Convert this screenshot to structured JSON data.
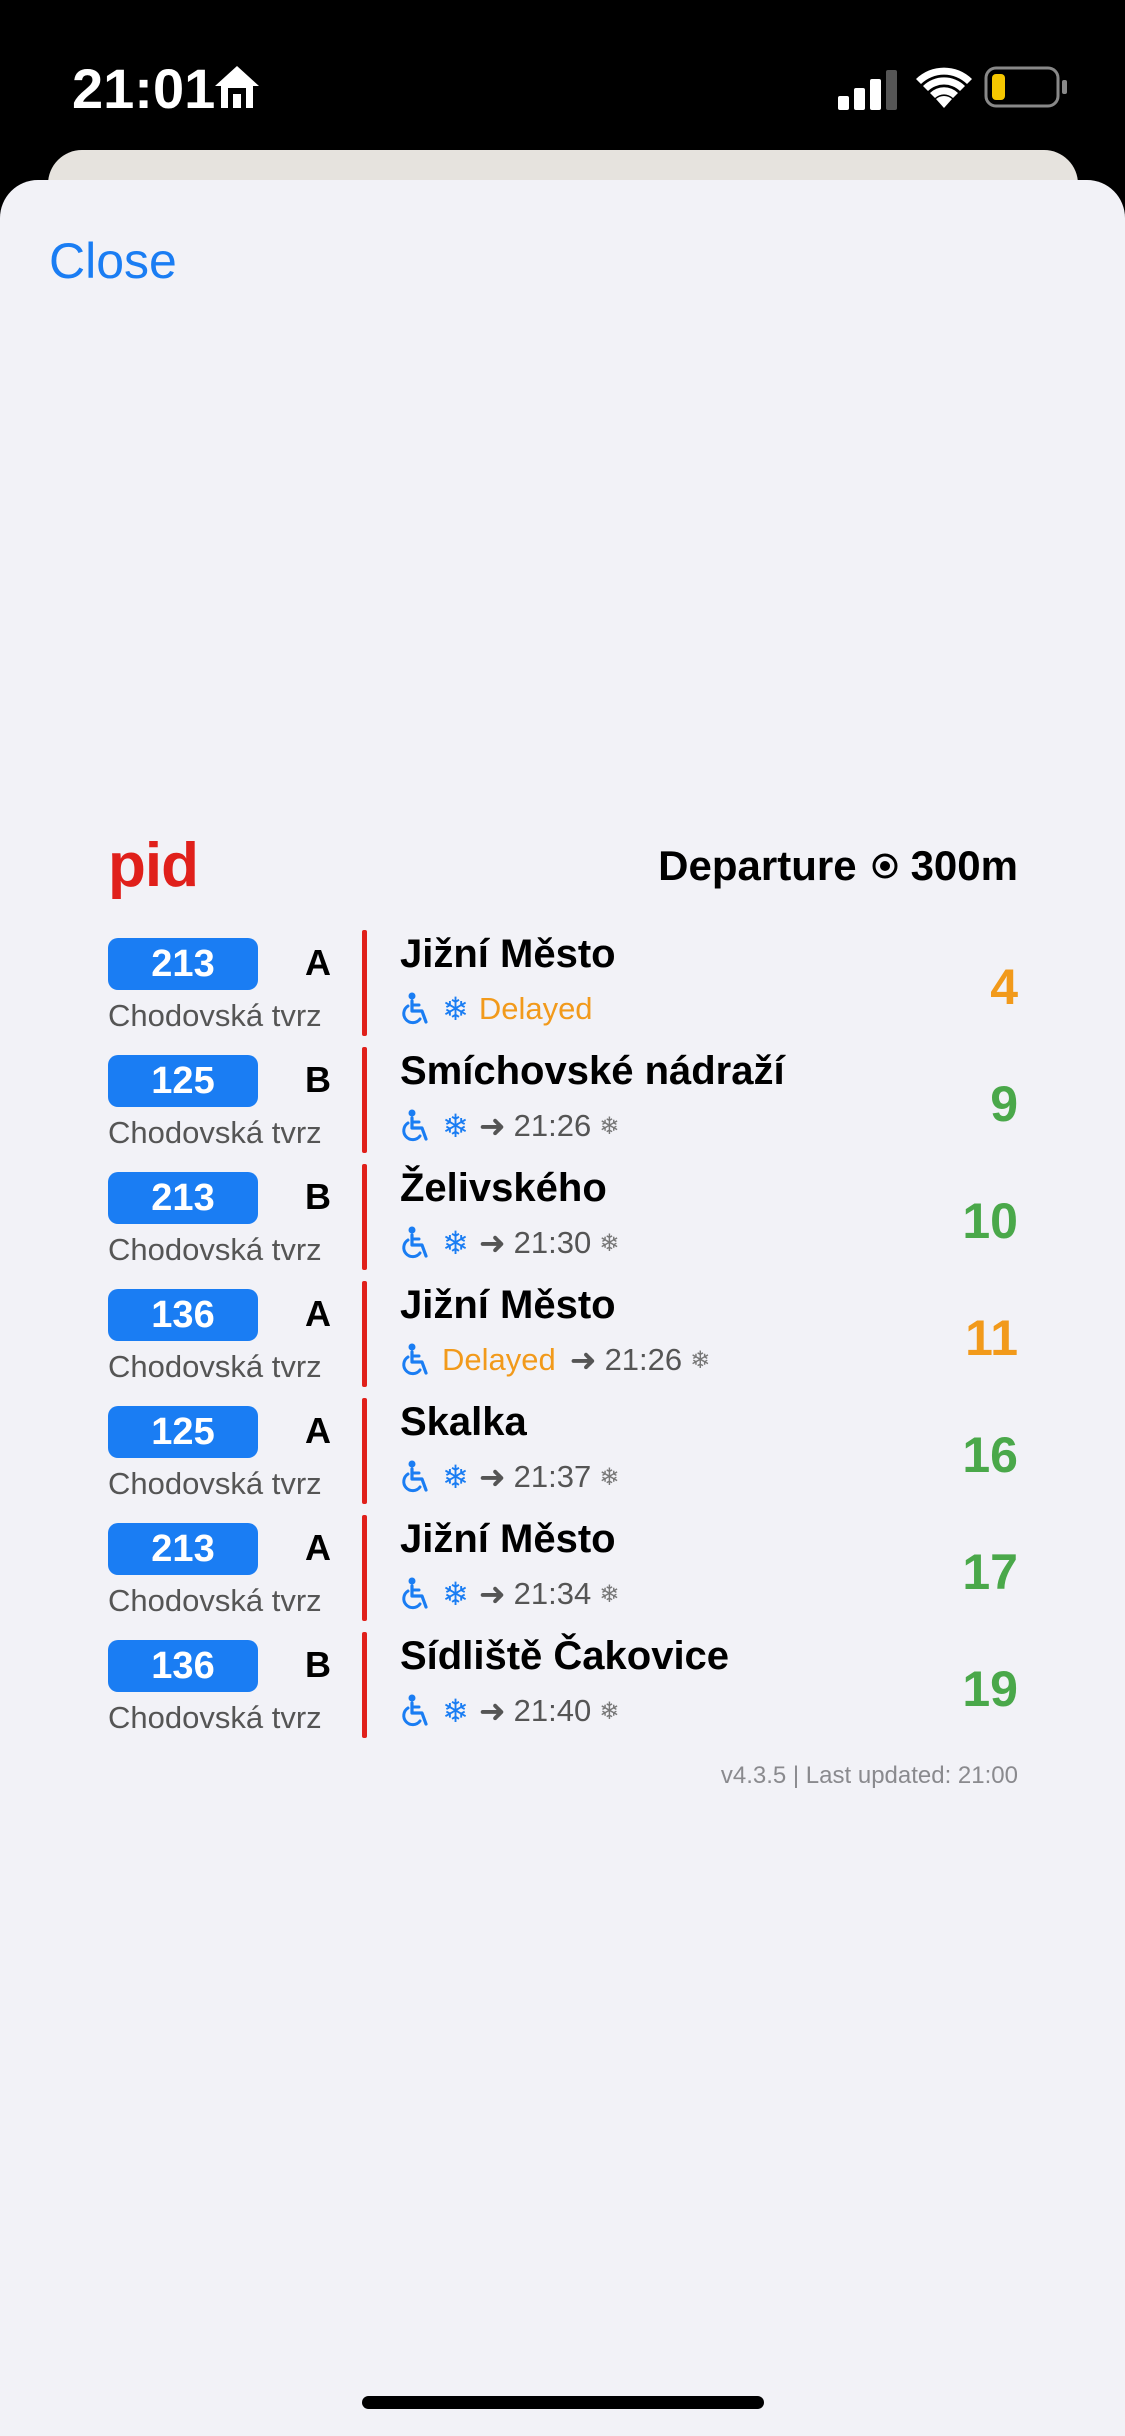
{
  "status_bar": {
    "time": "21:01",
    "battery_color": "#f6c700"
  },
  "sheet": {
    "close_label": "Close"
  },
  "widget": {
    "brand": "pid",
    "header": {
      "departure_label": "Departure",
      "distance": "300m"
    },
    "departures": [
      {
        "line": "213",
        "platform": "A",
        "stop": "Chodovská tvrz",
        "destination": "Jižní Město",
        "wheelchair": true,
        "ac": true,
        "delayed": true,
        "delayed_label": "Delayed",
        "next_time": "",
        "next_ac": false,
        "minutes": "4",
        "minutes_color": "orange"
      },
      {
        "line": "125",
        "platform": "B",
        "stop": "Chodovská tvrz",
        "destination": "Smíchovské nádraží",
        "wheelchair": true,
        "ac": true,
        "delayed": false,
        "delayed_label": "",
        "next_time": "21:26",
        "next_ac": true,
        "minutes": "9",
        "minutes_color": "green"
      },
      {
        "line": "213",
        "platform": "B",
        "stop": "Chodovská tvrz",
        "destination": "Želivského",
        "wheelchair": true,
        "ac": true,
        "delayed": false,
        "delayed_label": "",
        "next_time": "21:30",
        "next_ac": true,
        "minutes": "10",
        "minutes_color": "green"
      },
      {
        "line": "136",
        "platform": "A",
        "stop": "Chodovská tvrz",
        "destination": "Jižní Město",
        "wheelchair": true,
        "ac": false,
        "delayed": true,
        "delayed_label": "Delayed",
        "next_time": "21:26",
        "next_ac": true,
        "minutes": "11",
        "minutes_color": "orange"
      },
      {
        "line": "125",
        "platform": "A",
        "stop": "Chodovská tvrz",
        "destination": "Skalka",
        "wheelchair": true,
        "ac": true,
        "delayed": false,
        "delayed_label": "",
        "next_time": "21:37",
        "next_ac": true,
        "minutes": "16",
        "minutes_color": "green"
      },
      {
        "line": "213",
        "platform": "A",
        "stop": "Chodovská tvrz",
        "destination": "Jižní Město",
        "wheelchair": true,
        "ac": true,
        "delayed": false,
        "delayed_label": "",
        "next_time": "21:34",
        "next_ac": true,
        "minutes": "17",
        "minutes_color": "green"
      },
      {
        "line": "136",
        "platform": "B",
        "stop": "Chodovská tvrz",
        "destination": "Sídliště Čakovice",
        "wheelchair": true,
        "ac": true,
        "delayed": false,
        "delayed_label": "",
        "next_time": "21:40",
        "next_ac": true,
        "minutes": "19",
        "minutes_color": "green"
      }
    ],
    "footer": "v4.3.5 | Last updated: 21:00"
  },
  "colors": {
    "accent_blue": "#1a7df3",
    "brand_red": "#e0201b",
    "delay_orange": "#f29a1b",
    "ontime_green": "#4aa84a"
  },
  "icons": {
    "wheelchair": "wheelchair-icon",
    "ac": "snowflake-icon",
    "arrow": "arrow-right-icon",
    "target": "location-target-icon"
  }
}
